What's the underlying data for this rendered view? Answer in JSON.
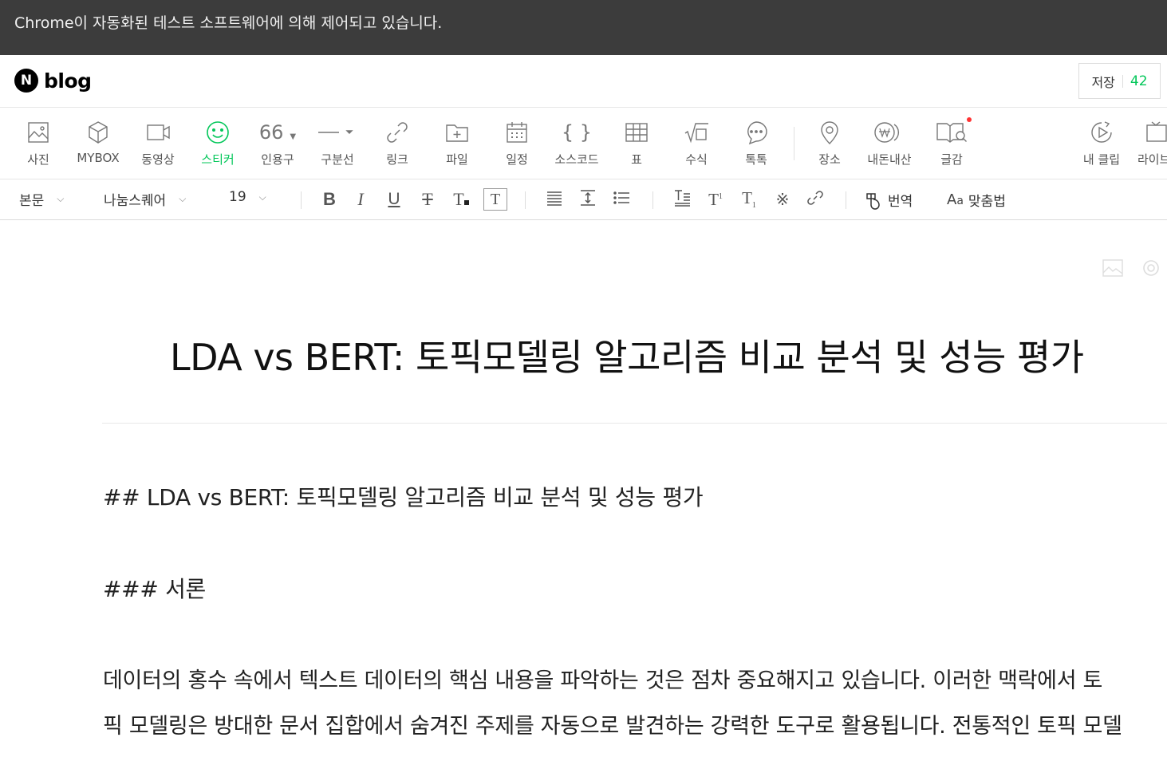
{
  "infobar": {
    "text": "Chrome이 자동화된 테스트 소프트웨어에 의해 제어되고 있습니다."
  },
  "header": {
    "logo_badge": "N",
    "logo_text": "blog",
    "save_label": "저장",
    "save_count": "42"
  },
  "toolbar": {
    "items": [
      {
        "label": "사진",
        "icon": "photo-icon"
      },
      {
        "label": "MYBOX",
        "icon": "mybox-icon"
      },
      {
        "label": "동영상",
        "icon": "video-icon"
      },
      {
        "label": "스티커",
        "icon": "sticker-icon"
      },
      {
        "label": "인용구",
        "icon": "quote-icon",
        "glyph": "66"
      },
      {
        "label": "구분선",
        "icon": "divider-line-icon"
      },
      {
        "label": "링크",
        "icon": "link-icon"
      },
      {
        "label": "파일",
        "icon": "file-icon"
      },
      {
        "label": "일정",
        "icon": "calendar-icon"
      },
      {
        "label": "소스코드",
        "icon": "source-code-icon",
        "glyph": "{ }"
      },
      {
        "label": "표",
        "icon": "table-icon"
      },
      {
        "label": "수식",
        "icon": "formula-icon"
      },
      {
        "label": "톡톡",
        "icon": "talk-icon"
      },
      {
        "label": "장소",
        "icon": "location-pin-icon"
      },
      {
        "label": "내돈내산",
        "icon": "won-coin-icon"
      },
      {
        "label": "글감",
        "icon": "book-search-icon"
      },
      {
        "label": "내 클립",
        "icon": "play-circle-icon"
      },
      {
        "label": "라이브",
        "icon": "live-icon"
      }
    ],
    "active_color": "#03c75a"
  },
  "formatbar": {
    "paragraph_style": "본문",
    "font_family": "나눔스퀘어",
    "font_size": "19",
    "translate_label": "번역",
    "spellcheck_label": "맞춤법"
  },
  "document": {
    "title": "LDA vs BERT: 토픽모델링 알고리즘 비교 분석 및 성능 평가",
    "paragraphs": [
      "## LDA vs BERT: 토픽모델링 알고리즘 비교 분석 및 성능 평가",
      "### 서론",
      "데이터의 홍수 속에서 텍스트 데이터의 핵심 내용을 파악하는 것은 점차 중요해지고 있습니다. 이러한 맥락에서 토",
      "픽 모델링은 방대한 문서 집합에서 숨겨진 주제를 자동으로 발견하는 강력한 도구로 활용됩니다. 전통적인 토픽 모델"
    ]
  }
}
